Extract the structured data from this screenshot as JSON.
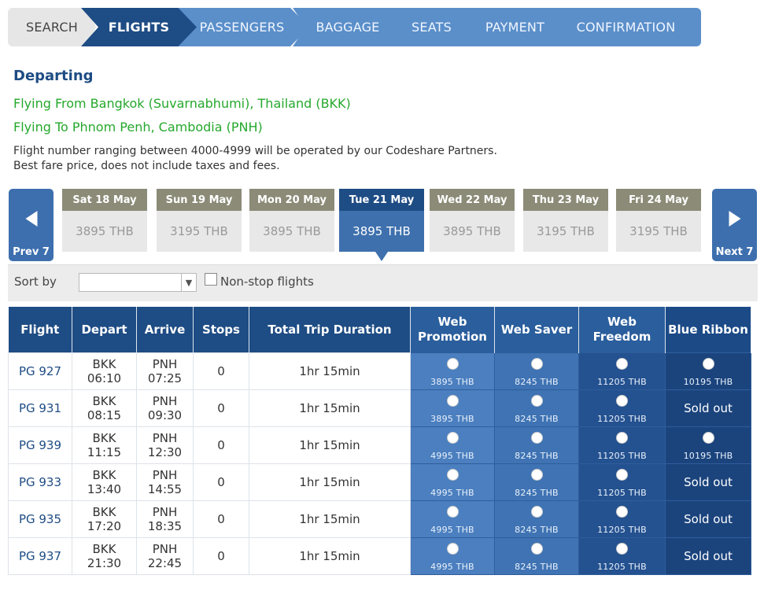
{
  "steps": [
    "SEARCH",
    "FLIGHTS",
    "PASSENGERS",
    "BAGGAGE",
    "SEATS",
    "PAYMENT",
    "CONFIRMATION"
  ],
  "heading": "Departing",
  "route_from": "Flying From Bangkok (Suvarnabhumi), Thailand (BKK)",
  "route_to": "Flying To Phnom Penh, Cambodia (PNH)",
  "notes": [
    "Flight number ranging between 4000-4999 will be operated by our Codeshare Partners.",
    "Best fare price, does not include taxes and fees."
  ],
  "carousel": {
    "prev_label": "Prev 7",
    "next_label": "Next 7",
    "days": [
      {
        "label": "Sat 18 May",
        "price": "3895 THB",
        "active": false
      },
      {
        "label": "Sun 19 May",
        "price": "3195 THB",
        "active": false
      },
      {
        "label": "Mon 20 May",
        "price": "3895 THB",
        "active": false
      },
      {
        "label": "Tue 21 May",
        "price": "3895 THB",
        "active": true
      },
      {
        "label": "Wed 22 May",
        "price": "3895 THB",
        "active": false
      },
      {
        "label": "Thu 23 May",
        "price": "3195 THB",
        "active": false
      },
      {
        "label": "Fri 24 May",
        "price": "3195 THB",
        "active": false
      }
    ]
  },
  "sort": {
    "label": "Sort by",
    "value": "",
    "nonstop_label": "Non-stop flights",
    "nonstop_checked": false
  },
  "table": {
    "headers": {
      "flight": "Flight",
      "depart": "Depart",
      "arrive": "Arrive",
      "stops": "Stops",
      "duration": "Total Trip Duration",
      "web_promotion": [
        "Web",
        "Promotion"
      ],
      "web_saver": "Web Saver",
      "web_freedom": [
        "Web",
        "Freedom"
      ],
      "blue_ribbon": "Blue Ribbon"
    },
    "rows": [
      {
        "flight": "PG 927",
        "dep_code": "BKK",
        "dep_time": "06:10",
        "arr_code": "PNH",
        "arr_time": "07:25",
        "stops": "0",
        "duration": "1hr 15min",
        "promo": "3895 THB",
        "saver": "8245 THB",
        "freedom": "11205 THB",
        "blue": "10195 THB"
      },
      {
        "flight": "PG 931",
        "dep_code": "BKK",
        "dep_time": "08:15",
        "arr_code": "PNH",
        "arr_time": "09:30",
        "stops": "0",
        "duration": "1hr 15min",
        "promo": "3895 THB",
        "saver": "8245 THB",
        "freedom": "11205 THB",
        "blue": "Sold out"
      },
      {
        "flight": "PG 939",
        "dep_code": "BKK",
        "dep_time": "11:15",
        "arr_code": "PNH",
        "arr_time": "12:30",
        "stops": "0",
        "duration": "1hr 15min",
        "promo": "4995 THB",
        "saver": "8245 THB",
        "freedom": "11205 THB",
        "blue": "10195 THB"
      },
      {
        "flight": "PG 933",
        "dep_code": "BKK",
        "dep_time": "13:40",
        "arr_code": "PNH",
        "arr_time": "14:55",
        "stops": "0",
        "duration": "1hr 15min",
        "promo": "4995 THB",
        "saver": "8245 THB",
        "freedom": "11205 THB",
        "blue": "Sold out"
      },
      {
        "flight": "PG 935",
        "dep_code": "BKK",
        "dep_time": "17:20",
        "arr_code": "PNH",
        "arr_time": "18:35",
        "stops": "0",
        "duration": "1hr 15min",
        "promo": "4995 THB",
        "saver": "8245 THB",
        "freedom": "11205 THB",
        "blue": "Sold out"
      },
      {
        "flight": "PG 937",
        "dep_code": "BKK",
        "dep_time": "21:30",
        "arr_code": "PNH",
        "arr_time": "22:45",
        "stops": "0",
        "duration": "1hr 15min",
        "promo": "4995 THB",
        "saver": "8245 THB",
        "freedom": "11205 THB",
        "blue": "Sold out"
      }
    ]
  },
  "colors": {
    "brand_dark": "#1e4c84",
    "step_light": "#5b8fca",
    "route_green": "#25a82c",
    "day_header": "#8c8b78",
    "web_promotion": "#4b7fbf",
    "web_saver": "#3f73b3",
    "web_freedom": "#24518f",
    "blue_ribbon": "#1b447d"
  }
}
